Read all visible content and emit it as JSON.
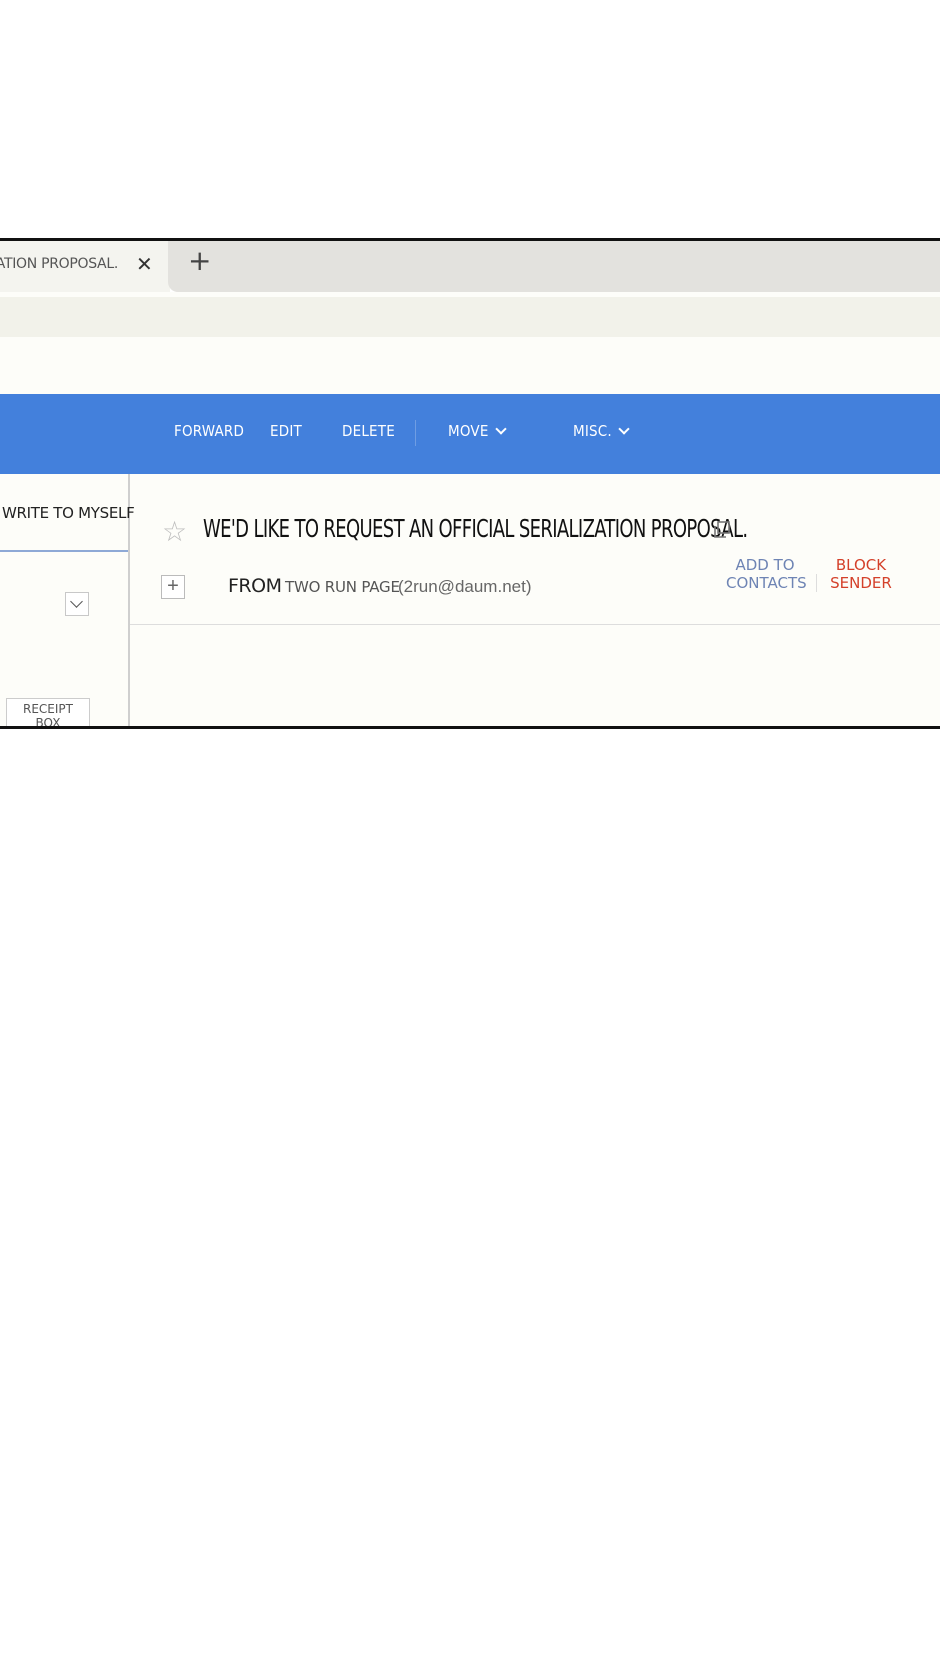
{
  "browser": {
    "tab_title": "WE'D LIKE TO REQUEST AN OFFICIAL SERIALIZATION PROPOSAL.",
    "close_glyph": "✕",
    "new_tab_glyph": "+"
  },
  "toolbar": {
    "background": "#4380dc",
    "forward_label": "FORWARD",
    "edit_label": "EDIT",
    "delete_label": "DELETE",
    "move_label": "MOVE",
    "misc_label": "MISC."
  },
  "sidebar": {
    "write_to_myself": "WRITE TO MYSELF",
    "receipt_box_line1": "RECEIPT",
    "receipt_box_line2": "BOX"
  },
  "mail": {
    "subject": "WE'D LIKE TO REQUEST AN OFFICIAL SERIALIZATION PROPOSAL.",
    "from_label": "FROM",
    "sender_name": "TWO RUN PAGE",
    "sender_email": "(2run@daum.net)",
    "add_contacts_line1": "ADD TO",
    "add_contacts_line2": "CONTACTS",
    "block_sender_line1": "BLOCK",
    "block_sender_line2": "SENDER",
    "star_glyph": "☆",
    "expand_glyph": "+"
  },
  "colors": {
    "accent": "#4380dc",
    "block": "#d4402a",
    "contacts": "#6e84b4"
  }
}
